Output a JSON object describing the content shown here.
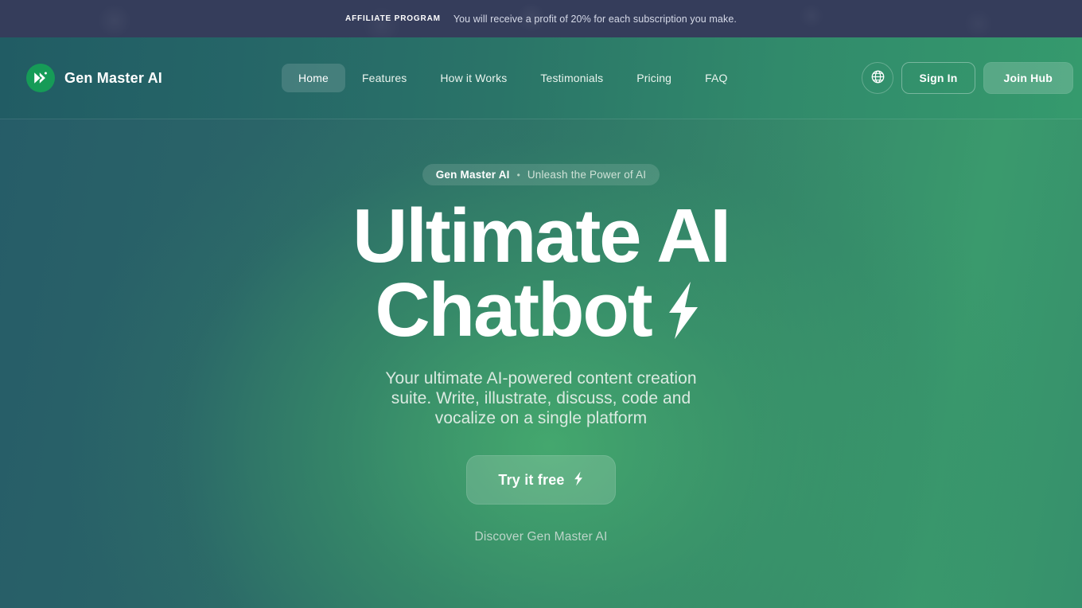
{
  "affiliate_banner": {
    "label": "AFFILIATE PROGRAM",
    "message": "You will receive a profit of 20% for each subscription you make."
  },
  "header": {
    "brand": {
      "name": "Gen Master AI",
      "logo_icon": "play-chevron-icon",
      "logo_color": "#169b57"
    },
    "nav": [
      {
        "label": "Home",
        "active": true
      },
      {
        "label": "Features",
        "active": false
      },
      {
        "label": "How it Works",
        "active": false
      },
      {
        "label": "Testimonials",
        "active": false
      },
      {
        "label": "Pricing",
        "active": false
      },
      {
        "label": "FAQ",
        "active": false
      }
    ],
    "actions": {
      "language_icon": "globe-icon",
      "sign_in_label": "Sign In",
      "join_hub_label": "Join Hub"
    }
  },
  "hero": {
    "badge": {
      "brand": "Gen Master AI",
      "separator": "•",
      "tagline": "Unleash the Power of AI"
    },
    "title_line_1": "Ultimate AI",
    "title_line_2": "Chatbot",
    "title_icon": "lightning-bolt-icon",
    "subtitle": "Your ultimate AI-powered content creation suite. Write, illustrate, discuss, code and vocalize on a single platform",
    "cta_label": "Try it free",
    "cta_icon": "lightning-bolt-icon",
    "discover_label": "Discover Gen Master AI"
  },
  "theme": {
    "banner_bg": "#353d5b",
    "gradient_left": "#265c68",
    "gradient_right": "#3a9a6d",
    "accent_green": "#169b57",
    "text_light": "#ffffff",
    "text_muted": "#cfe2d7"
  }
}
